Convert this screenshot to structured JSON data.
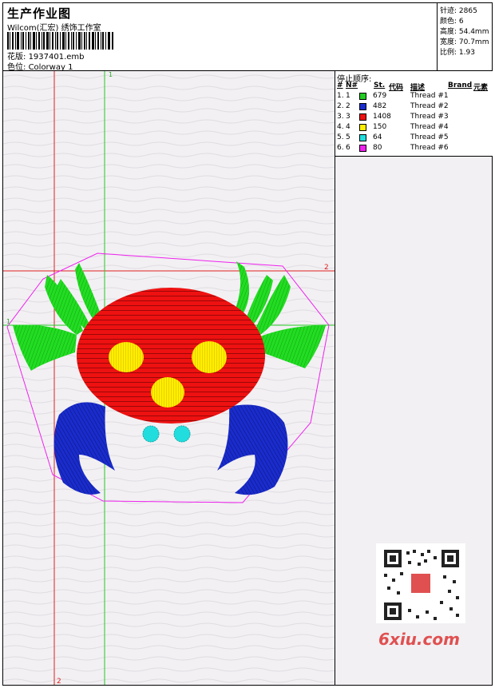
{
  "header": {
    "title": "生产作业图",
    "company": "Wilcom(汇宏) 绣饰工作室",
    "design_label": "花版:",
    "design_value": "1937401.emb",
    "color_label": "色位:",
    "color_value": "Colorway 1"
  },
  "stats": {
    "stitches": "针迹: 2865",
    "colors": "颜色: 6",
    "height": "高度: 54.4mm",
    "width": "宽度: 70.7mm",
    "ratio": "比例: 1.93"
  },
  "panel": {
    "title": "停止顺序:",
    "col_num": "#",
    "col_n": "N#",
    "col_st": "St.",
    "col_code": "代码",
    "col_desc": "描述",
    "col_brand": "Brand",
    "col_element": "元素"
  },
  "threads": [
    {
      "num": "1.",
      "n": "1",
      "color": "#22cc22",
      "st": "679",
      "desc": "Thread #1"
    },
    {
      "num": "2.",
      "n": "2",
      "color": "#1a2ccc",
      "st": "482",
      "desc": "Thread #2"
    },
    {
      "num": "3.",
      "n": "3",
      "color": "#ee1111",
      "st": "1408",
      "desc": "Thread #3"
    },
    {
      "num": "4.",
      "n": "4",
      "color": "#ffee00",
      "st": "150",
      "desc": "Thread #4"
    },
    {
      "num": "5.",
      "n": "5",
      "color": "#22dddd",
      "st": "64",
      "desc": "Thread #5"
    },
    {
      "num": "6.",
      "n": "6",
      "color": "#ee22ee",
      "st": "80",
      "desc": "Thread #6"
    }
  ],
  "guides": {
    "label_1": "1",
    "label_2": "2"
  },
  "watermark": "6xiu.com"
}
